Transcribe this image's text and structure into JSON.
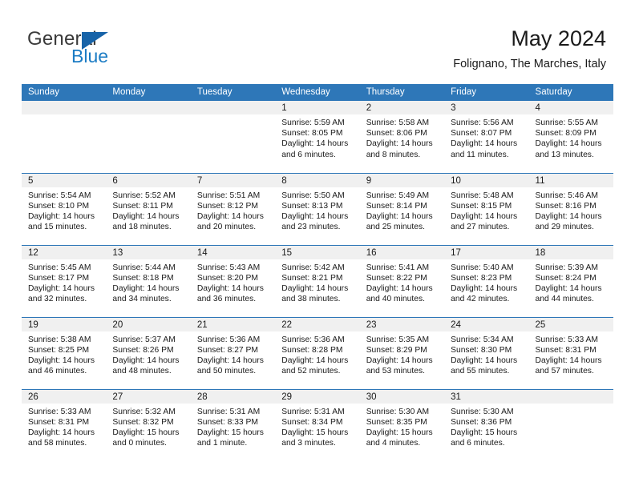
{
  "brand": {
    "name_part1": "General",
    "name_part2": "Blue",
    "triangle_color": "#1763a8",
    "blue_color": "#1c7cc4",
    "gray_color": "#3a3a3a"
  },
  "header": {
    "title": "May 2024",
    "subtitle": "Folignano, The Marches, Italy",
    "accent_color": "#2e77b8",
    "band_color": "#f0f0f0"
  },
  "weekday_headers": [
    "Sunday",
    "Monday",
    "Tuesday",
    "Wednesday",
    "Thursday",
    "Friday",
    "Saturday"
  ],
  "labels": {
    "sunrise_prefix": "Sunrise:",
    "sunset_prefix": "Sunset:",
    "daylight_prefix": "Daylight:"
  },
  "weeks": [
    [
      {
        "day": "",
        "sunrise": "",
        "sunset": "",
        "daylight": "",
        "empty": true
      },
      {
        "day": "",
        "sunrise": "",
        "sunset": "",
        "daylight": "",
        "empty": true
      },
      {
        "day": "",
        "sunrise": "",
        "sunset": "",
        "daylight": "",
        "empty": true
      },
      {
        "day": "1",
        "sunrise": "Sunrise: 5:59 AM",
        "sunset": "Sunset: 8:05 PM",
        "daylight": "Daylight: 14 hours and 6 minutes.",
        "empty": false
      },
      {
        "day": "2",
        "sunrise": "Sunrise: 5:58 AM",
        "sunset": "Sunset: 8:06 PM",
        "daylight": "Daylight: 14 hours and 8 minutes.",
        "empty": false
      },
      {
        "day": "3",
        "sunrise": "Sunrise: 5:56 AM",
        "sunset": "Sunset: 8:07 PM",
        "daylight": "Daylight: 14 hours and 11 minutes.",
        "empty": false
      },
      {
        "day": "4",
        "sunrise": "Sunrise: 5:55 AM",
        "sunset": "Sunset: 8:09 PM",
        "daylight": "Daylight: 14 hours and 13 minutes.",
        "empty": false
      }
    ],
    [
      {
        "day": "5",
        "sunrise": "Sunrise: 5:54 AM",
        "sunset": "Sunset: 8:10 PM",
        "daylight": "Daylight: 14 hours and 15 minutes.",
        "empty": false
      },
      {
        "day": "6",
        "sunrise": "Sunrise: 5:52 AM",
        "sunset": "Sunset: 8:11 PM",
        "daylight": "Daylight: 14 hours and 18 minutes.",
        "empty": false
      },
      {
        "day": "7",
        "sunrise": "Sunrise: 5:51 AM",
        "sunset": "Sunset: 8:12 PM",
        "daylight": "Daylight: 14 hours and 20 minutes.",
        "empty": false
      },
      {
        "day": "8",
        "sunrise": "Sunrise: 5:50 AM",
        "sunset": "Sunset: 8:13 PM",
        "daylight": "Daylight: 14 hours and 23 minutes.",
        "empty": false
      },
      {
        "day": "9",
        "sunrise": "Sunrise: 5:49 AM",
        "sunset": "Sunset: 8:14 PM",
        "daylight": "Daylight: 14 hours and 25 minutes.",
        "empty": false
      },
      {
        "day": "10",
        "sunrise": "Sunrise: 5:48 AM",
        "sunset": "Sunset: 8:15 PM",
        "daylight": "Daylight: 14 hours and 27 minutes.",
        "empty": false
      },
      {
        "day": "11",
        "sunrise": "Sunrise: 5:46 AM",
        "sunset": "Sunset: 8:16 PM",
        "daylight": "Daylight: 14 hours and 29 minutes.",
        "empty": false
      }
    ],
    [
      {
        "day": "12",
        "sunrise": "Sunrise: 5:45 AM",
        "sunset": "Sunset: 8:17 PM",
        "daylight": "Daylight: 14 hours and 32 minutes.",
        "empty": false
      },
      {
        "day": "13",
        "sunrise": "Sunrise: 5:44 AM",
        "sunset": "Sunset: 8:18 PM",
        "daylight": "Daylight: 14 hours and 34 minutes.",
        "empty": false
      },
      {
        "day": "14",
        "sunrise": "Sunrise: 5:43 AM",
        "sunset": "Sunset: 8:20 PM",
        "daylight": "Daylight: 14 hours and 36 minutes.",
        "empty": false
      },
      {
        "day": "15",
        "sunrise": "Sunrise: 5:42 AM",
        "sunset": "Sunset: 8:21 PM",
        "daylight": "Daylight: 14 hours and 38 minutes.",
        "empty": false
      },
      {
        "day": "16",
        "sunrise": "Sunrise: 5:41 AM",
        "sunset": "Sunset: 8:22 PM",
        "daylight": "Daylight: 14 hours and 40 minutes.",
        "empty": false
      },
      {
        "day": "17",
        "sunrise": "Sunrise: 5:40 AM",
        "sunset": "Sunset: 8:23 PM",
        "daylight": "Daylight: 14 hours and 42 minutes.",
        "empty": false
      },
      {
        "day": "18",
        "sunrise": "Sunrise: 5:39 AM",
        "sunset": "Sunset: 8:24 PM",
        "daylight": "Daylight: 14 hours and 44 minutes.",
        "empty": false
      }
    ],
    [
      {
        "day": "19",
        "sunrise": "Sunrise: 5:38 AM",
        "sunset": "Sunset: 8:25 PM",
        "daylight": "Daylight: 14 hours and 46 minutes.",
        "empty": false
      },
      {
        "day": "20",
        "sunrise": "Sunrise: 5:37 AM",
        "sunset": "Sunset: 8:26 PM",
        "daylight": "Daylight: 14 hours and 48 minutes.",
        "empty": false
      },
      {
        "day": "21",
        "sunrise": "Sunrise: 5:36 AM",
        "sunset": "Sunset: 8:27 PM",
        "daylight": "Daylight: 14 hours and 50 minutes.",
        "empty": false
      },
      {
        "day": "22",
        "sunrise": "Sunrise: 5:36 AM",
        "sunset": "Sunset: 8:28 PM",
        "daylight": "Daylight: 14 hours and 52 minutes.",
        "empty": false
      },
      {
        "day": "23",
        "sunrise": "Sunrise: 5:35 AM",
        "sunset": "Sunset: 8:29 PM",
        "daylight": "Daylight: 14 hours and 53 minutes.",
        "empty": false
      },
      {
        "day": "24",
        "sunrise": "Sunrise: 5:34 AM",
        "sunset": "Sunset: 8:30 PM",
        "daylight": "Daylight: 14 hours and 55 minutes.",
        "empty": false
      },
      {
        "day": "25",
        "sunrise": "Sunrise: 5:33 AM",
        "sunset": "Sunset: 8:31 PM",
        "daylight": "Daylight: 14 hours and 57 minutes.",
        "empty": false
      }
    ],
    [
      {
        "day": "26",
        "sunrise": "Sunrise: 5:33 AM",
        "sunset": "Sunset: 8:31 PM",
        "daylight": "Daylight: 14 hours and 58 minutes.",
        "empty": false
      },
      {
        "day": "27",
        "sunrise": "Sunrise: 5:32 AM",
        "sunset": "Sunset: 8:32 PM",
        "daylight": "Daylight: 15 hours and 0 minutes.",
        "empty": false
      },
      {
        "day": "28",
        "sunrise": "Sunrise: 5:31 AM",
        "sunset": "Sunset: 8:33 PM",
        "daylight": "Daylight: 15 hours and 1 minute.",
        "empty": false
      },
      {
        "day": "29",
        "sunrise": "Sunrise: 5:31 AM",
        "sunset": "Sunset: 8:34 PM",
        "daylight": "Daylight: 15 hours and 3 minutes.",
        "empty": false
      },
      {
        "day": "30",
        "sunrise": "Sunrise: 5:30 AM",
        "sunset": "Sunset: 8:35 PM",
        "daylight": "Daylight: 15 hours and 4 minutes.",
        "empty": false
      },
      {
        "day": "31",
        "sunrise": "Sunrise: 5:30 AM",
        "sunset": "Sunset: 8:36 PM",
        "daylight": "Daylight: 15 hours and 6 minutes.",
        "empty": false
      },
      {
        "day": "",
        "sunrise": "",
        "sunset": "",
        "daylight": "",
        "empty": true
      }
    ]
  ]
}
